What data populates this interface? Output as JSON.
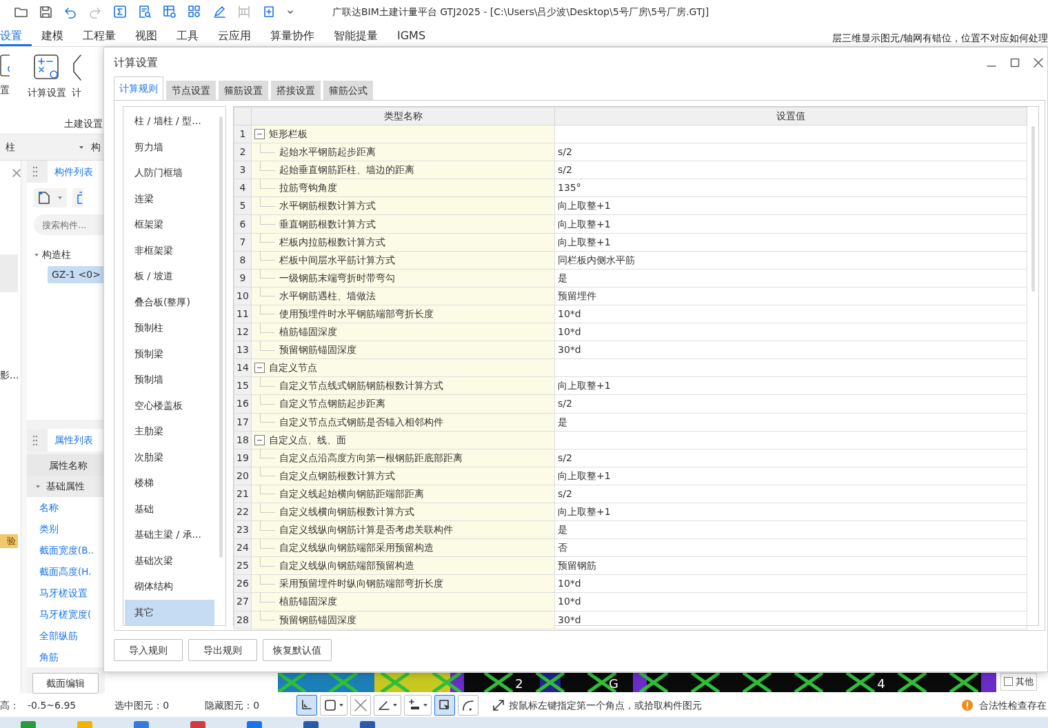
{
  "title_bar": {
    "title": "广联达BIM土建计量平台 GTJ2025 - [C:\\Users\\吕少波\\Desktop\\5号厂房\\5号厂房.GTJ]"
  },
  "menu": {
    "tabs": [
      {
        "label": "设置",
        "selected": true
      },
      {
        "label": "建模",
        "selected": false
      },
      {
        "label": "工程量",
        "selected": false
      },
      {
        "label": "视图",
        "selected": false
      },
      {
        "label": "工具",
        "selected": false
      },
      {
        "label": "云应用",
        "selected": false
      },
      {
        "label": "算量协作",
        "selected": false
      },
      {
        "label": "智能提量",
        "selected": false
      },
      {
        "label": "IGMS",
        "selected": false
      }
    ],
    "hint": "层三维显示图元/轴网有错位，位置不对应如何处理"
  },
  "ribbon": {
    "buttons": [
      "置",
      "计算设置",
      "计"
    ],
    "group_label": "土建设置"
  },
  "left_panel": {
    "category_select": "柱",
    "column_2": "构",
    "side_text": "影...",
    "badge": "验",
    "component_list": {
      "tab": "构件列表",
      "search": {
        "placeholder": "搜索构件..."
      },
      "tree": [
        {
          "label": "构造柱",
          "expanded": true,
          "children": [
            {
              "label": "GZ-1 <0>",
              "selected": true
            }
          ]
        }
      ]
    },
    "properties": {
      "tab": "属性列表",
      "header": "属性名称",
      "groups": [
        {
          "label": "基础属性",
          "expanded": true,
          "items": [
            "名称",
            "类别",
            "截面宽度(B..",
            "截面高度(H.",
            "马牙槎设置",
            "马牙槎宽度(",
            "全部纵筋",
            "角筋"
          ]
        }
      ],
      "edit_button": "截面编辑"
    }
  },
  "dialog": {
    "title": "计算设置",
    "tabs": [
      {
        "label": "计算规则",
        "selected": true
      },
      {
        "label": "节点设置",
        "selected": false
      },
      {
        "label": "箍筋设置",
        "selected": false
      },
      {
        "label": "搭接设置",
        "selected": false
      },
      {
        "label": "箍筋公式",
        "selected": false
      }
    ],
    "categories": [
      {
        "label": "柱 / 墙柱 / 型...",
        "selected": false
      },
      {
        "label": "剪力墙",
        "selected": false
      },
      {
        "label": "人防门框墙",
        "selected": false
      },
      {
        "label": "连梁",
        "selected": false
      },
      {
        "label": "框架梁",
        "selected": false
      },
      {
        "label": "非框架梁",
        "selected": false
      },
      {
        "label": "板 / 坡道",
        "selected": false
      },
      {
        "label": "叠合板(整厚)",
        "selected": false
      },
      {
        "label": "预制柱",
        "selected": false
      },
      {
        "label": "预制梁",
        "selected": false
      },
      {
        "label": "预制墙",
        "selected": false
      },
      {
        "label": "空心楼盖板",
        "selected": false
      },
      {
        "label": "主肋梁",
        "selected": false
      },
      {
        "label": "次肋梁",
        "selected": false
      },
      {
        "label": "楼梯",
        "selected": false
      },
      {
        "label": "基础",
        "selected": false
      },
      {
        "label": "基础主梁 / 承...",
        "selected": false
      },
      {
        "label": "基础次梁",
        "selected": false
      },
      {
        "label": "砌体结构",
        "selected": false
      },
      {
        "label": "其它",
        "selected": true
      }
    ],
    "table": {
      "columns": [
        "类型名称",
        "设置值"
      ],
      "rows": [
        {
          "number": "1",
          "name": "矩形栏板",
          "expanded": true,
          "children": [
            {
              "number": "2",
              "name": "起始水平钢筋起步距离",
              "value": "s/2"
            },
            {
              "number": "3",
              "name": "起始垂直钢筋距柱、墙边的距离",
              "value": "s/2"
            },
            {
              "number": "4",
              "name": "拉筋弯钩角度",
              "value": "135°"
            },
            {
              "number": "5",
              "name": "水平钢筋根数计算方式",
              "value": "向上取整+1"
            },
            {
              "number": "6",
              "name": "垂直钢筋根数计算方式",
              "value": "向上取整+1"
            },
            {
              "number": "7",
              "name": "栏板内拉筋根数计算方式",
              "value": "向上取整+1"
            },
            {
              "number": "8",
              "name": "栏板中间层水平筋计算方式",
              "value": "同栏板内侧水平筋"
            },
            {
              "number": "9",
              "name": "一级钢筋末端弯折时带弯勾",
              "value": "是"
            },
            {
              "number": "10",
              "name": "水平钢筋遇柱、墙做法",
              "value": "预留埋件"
            },
            {
              "number": "11",
              "name": "使用预埋件时水平钢筋端部弯折长度",
              "value": "10*d"
            },
            {
              "number": "12",
              "name": "植筋锚固深度",
              "value": "10*d"
            },
            {
              "number": "13",
              "name": "预留钢筋锚固深度",
              "value": "30*d"
            }
          ]
        },
        {
          "number": "14",
          "name": "自定义节点",
          "expanded": true,
          "children": [
            {
              "number": "15",
              "name": "自定义节点线式钢筋钢筋根数计算方式",
              "value": "向上取整+1"
            },
            {
              "number": "16",
              "name": "自定义节点钢筋起步距离",
              "value": "s/2"
            },
            {
              "number": "17",
              "name": "自定义节点点式钢筋是否锚入相邻构件",
              "value": "是"
            }
          ]
        },
        {
          "number": "18",
          "name": "自定义点、线、面",
          "expanded": true,
          "children": [
            {
              "number": "19",
              "name": "自定义点沿高度方向第一根钢筋距底部距离",
              "value": "s/2"
            },
            {
              "number": "20",
              "name": "自定义点钢筋根数计算方式",
              "value": "向上取整+1"
            },
            {
              "number": "21",
              "name": "自定义线起始横向钢筋距端部距离",
              "value": "s/2"
            },
            {
              "number": "22",
              "name": "自定义线横向钢筋根数计算方式",
              "value": "向上取整+1"
            },
            {
              "number": "23",
              "name": "自定义线纵向钢筋计算是否考虑关联构件",
              "value": "是"
            },
            {
              "number": "24",
              "name": "自定义线纵向钢筋端部采用预留构造",
              "value": "否"
            },
            {
              "number": "25",
              "name": "自定义线纵向钢筋端部预留构造",
              "value": "预留钢筋"
            },
            {
              "number": "26",
              "name": "采用预留埋件时纵向钢筋端部弯折长度",
              "value": "10*d"
            },
            {
              "number": "27",
              "name": "植筋锚固深度",
              "value": "10*d"
            },
            {
              "number": "28",
              "name": "预留钢筋锚固深度",
              "value": "30*d"
            }
          ]
        }
      ]
    },
    "buttons": [
      "导入规则",
      "导出规则",
      "恢复默认值"
    ]
  },
  "canvas": {
    "axis_labels": [
      "2",
      "G",
      "4"
    ],
    "other_area": {
      "label": "其他",
      "checked": false
    }
  },
  "status_bar": {
    "elevation_label": "高：",
    "elevation": "-0.5~6.95",
    "selected_count": "选中图元：0",
    "hidden_count": "隐藏图元：0",
    "tools": [
      {
        "selected": true,
        "dropdown": false
      },
      {
        "selected": false,
        "dropdown": true
      },
      {
        "selected": false,
        "dropdown": false
      },
      {
        "selected": false,
        "dropdown": true
      },
      {
        "selected": false,
        "dropdown": true
      },
      {
        "selected": true,
        "dropdown": false
      },
      {
        "selected": false,
        "dropdown": false
      }
    ],
    "hint": "按鼠标左键指定第一个角点，或拾取构件图元",
    "warning": "合法性检查存在"
  }
}
